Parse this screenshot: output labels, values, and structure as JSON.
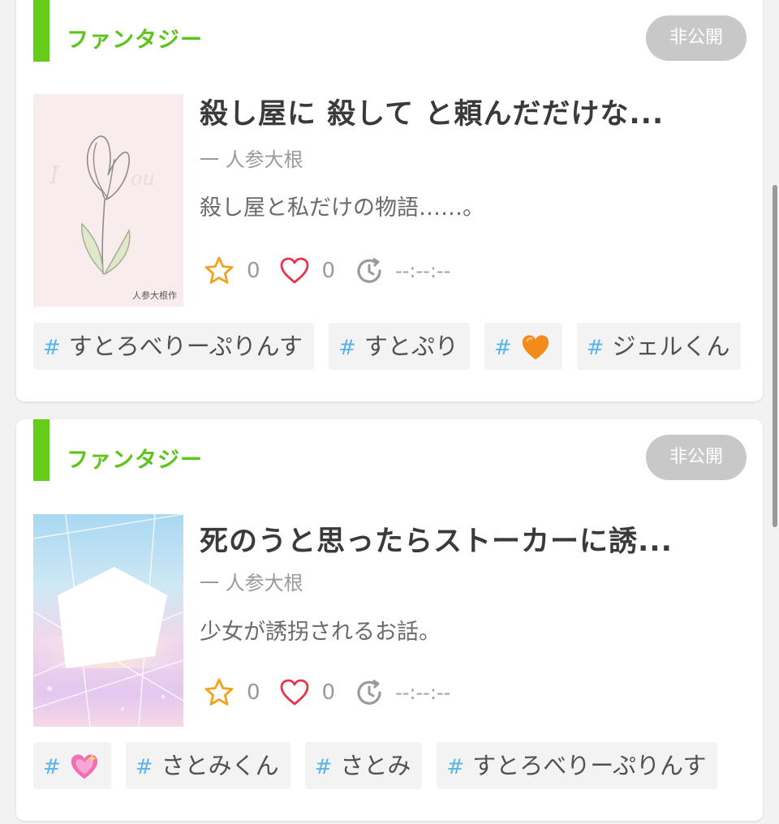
{
  "colors": {
    "genre_green": "#5ec41b",
    "badge_gray": "#c8c8c8",
    "hash_blue": "#5ab4e8",
    "star_orange": "#f2a21e",
    "heart_red": "#e8334a"
  },
  "novels": [
    {
      "genre": "ファンタジー",
      "status": "非公開",
      "title": "殺し屋に 殺して と頼んだだけな...",
      "author": "一 人参大根",
      "description": "殺し屋と私だけの物語……。",
      "cover_caption": "人参大根作",
      "stars": "0",
      "likes": "0",
      "updated": "--:--:--",
      "tags": [
        {
          "hash": "#",
          "label": "すとろべりーぷりんす",
          "icon": null
        },
        {
          "hash": "#",
          "label": "すとぷり",
          "icon": null
        },
        {
          "hash": "#",
          "label": "",
          "icon": "orange-heart-emoji"
        },
        {
          "hash": "#",
          "label": "ジェルくん",
          "icon": null
        }
      ]
    },
    {
      "genre": "ファンタジー",
      "status": "非公開",
      "title": "死のうと思ったらストーカーに誘...",
      "author": "一 人参大根",
      "description": "少女が誘拐されるお話。",
      "stars": "0",
      "likes": "0",
      "updated": "--:--:--",
      "tags": [
        {
          "hash": "#",
          "label": "",
          "icon": "sparkling-pink-heart-emoji"
        },
        {
          "hash": "#",
          "label": "さとみくん",
          "icon": null
        },
        {
          "hash": "#",
          "label": "さとみ",
          "icon": null
        },
        {
          "hash": "#",
          "label": "すとろべりーぷりんす",
          "icon": null
        }
      ]
    }
  ]
}
